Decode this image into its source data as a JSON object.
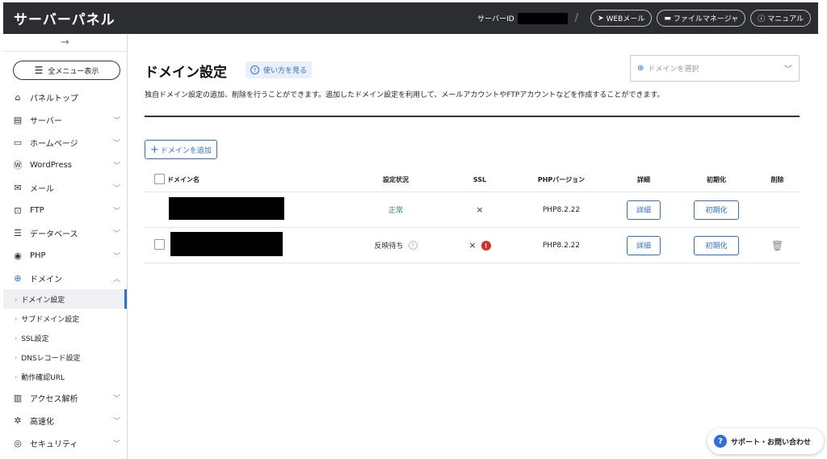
{
  "header": {
    "brand": "サーバーパネル",
    "server_id_label": "サーバーID",
    "slash": "/",
    "links": [
      {
        "icon": "send-icon",
        "label": "WEBメール"
      },
      {
        "icon": "folder-icon",
        "label": "ファイルマネージャ"
      },
      {
        "icon": "help-icon",
        "label": "マニュアル"
      }
    ]
  },
  "sidebar": {
    "collapse_glyph": "→",
    "all_menu_label": "全メニュー表示",
    "items": [
      {
        "icon": "home-icon",
        "label": "パネルトップ",
        "expandable": false
      },
      {
        "icon": "server-icon",
        "label": "サーバー",
        "expandable": true
      },
      {
        "icon": "browser-icon",
        "label": "ホームページ",
        "expandable": true
      },
      {
        "icon": "wordpress-icon",
        "label": "WordPress",
        "expandable": true
      },
      {
        "icon": "mail-icon",
        "label": "メール",
        "expandable": true
      },
      {
        "icon": "ftp-icon",
        "label": "FTP",
        "expandable": true
      },
      {
        "icon": "database-icon",
        "label": "データベース",
        "expandable": true
      },
      {
        "icon": "php-icon",
        "label": "PHP",
        "expandable": true
      },
      {
        "icon": "globe-icon",
        "label": "ドメイン",
        "expandable": true,
        "expanded": true
      }
    ],
    "domain_subitems": [
      "ドメイン設定",
      "サブドメイン設定",
      "SSL設定",
      "DNSレコード設定",
      "動作確認URL"
    ],
    "items_after": [
      {
        "icon": "chart-icon",
        "label": "アクセス解析"
      },
      {
        "icon": "speed-icon",
        "label": "高速化"
      },
      {
        "icon": "shield-icon",
        "label": "セキュリティ"
      }
    ]
  },
  "main": {
    "title": "ドメイン設定",
    "howto_label": "使い方を見る",
    "domain_select_placeholder": "ドメインを選択",
    "description": "独自ドメイン設定の追加、削除を行うことができます。追加したドメイン設定を利用して、メールアカウントやFTPアカウントなどを作成することができます。",
    "add_button": "ドメインを追加",
    "columns": [
      "ドメイン名",
      "設定状況",
      "SSL",
      "PHPバージョン",
      "詳細",
      "初期化",
      "削除"
    ],
    "rows": [
      {
        "status": "正常",
        "status_type": "ok",
        "ssl": "×",
        "ssl_warning": false,
        "php": "PHP8.2.22",
        "detail": "詳細",
        "init": "初期化",
        "deletable": false,
        "checkbox": false
      },
      {
        "status": "反映待ち",
        "status_type": "pending",
        "ssl": "×",
        "ssl_warning": true,
        "php": "PHP8.2.22",
        "detail": "詳細",
        "init": "初期化",
        "deletable": true,
        "checkbox": true
      }
    ]
  },
  "support": {
    "label": "サポート・お問い合わせ"
  },
  "colors": {
    "accent": "#2f6fd6",
    "topbar": "#2b2d30",
    "ok": "#2a8a56",
    "warning": "#d92b2b"
  }
}
